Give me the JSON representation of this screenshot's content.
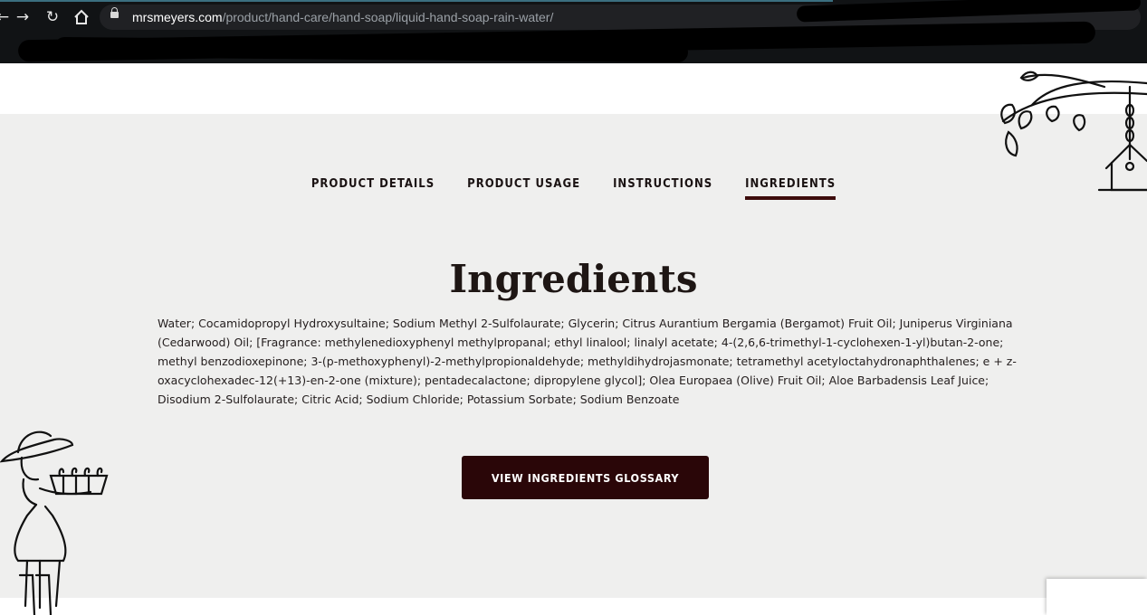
{
  "browser": {
    "url_domain": "mrsmeyers.com",
    "url_path": "/product/hand-care/hand-soap/liquid-hand-soap-rain-water/",
    "icons": [
      "back-arrow-icon",
      "forward-arrow-icon",
      "reload-icon",
      "home-icon",
      "lock-icon"
    ]
  },
  "tabs": [
    {
      "label": "PRODUCT DETAILS",
      "active": false
    },
    {
      "label": "PRODUCT USAGE",
      "active": false
    },
    {
      "label": "INSTRUCTIONS",
      "active": false
    },
    {
      "label": "INGREDIENTS",
      "active": true
    }
  ],
  "section": {
    "title": "Ingredients",
    "ingredients_text": "Water; Cocamidopropyl Hydroxysultaine; Sodium Methyl 2-Sulfolaurate; Glycerin; Citrus Aurantium Bergamia (Bergamot) Fruit Oil; Juniperus Virginiana (Cedarwood) Oil; [Fragrance: methylenedioxyphenyl methylpropanal; ethyl linalool; linalyl acetate; 4-(2,6,6-trimethyl-1-cyclohexen-1-yl)butan-2-one; methyl benzodioxepinone; 3-(p-methoxyphenyl)-2-methylpropionaldehyde; methyldihydrojasmonate; tetramethyl acetyloctahydronaphthalenes; e + z-oxacyclohexadec-12(+13)-en-2-one (mixture); pentadecalactone; dipropylene glycol]; Olea Europaea (Olive) Fruit Oil; Aloe Barbadensis Leaf Juice; Disodium 2-Sulfolaurate; Citric Acid; Sodium Chloride; Potassium Sorbate; Sodium Benzoate",
    "button_label": "VIEW INGREDIENTS GLOSSARY"
  },
  "colors": {
    "panel_bg": "#efefee",
    "accent": "#3d0c0c",
    "button_bg": "#2a0608",
    "text": "#1e1614"
  }
}
